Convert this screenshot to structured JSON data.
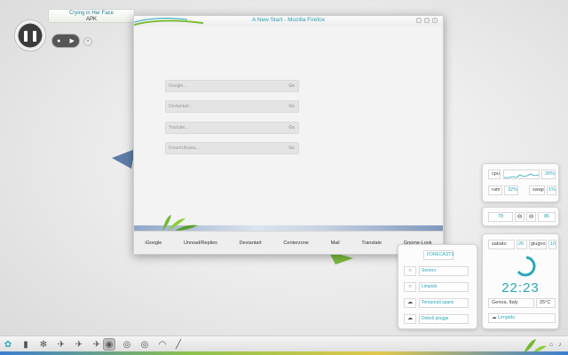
{
  "media_player": {
    "song": "Crying in Her Face",
    "artist": "APK",
    "play_icon": "pause-icon",
    "next_icon": "next-icon"
  },
  "firefox": {
    "title": "A New Start - Mozilla Firefox",
    "search_rows": [
      {
        "label": "Google...",
        "go": "Go"
      },
      {
        "label": "Deviantart...",
        "go": "Go"
      },
      {
        "label": "Youtube...",
        "go": "Go"
      },
      {
        "label": "ForumUbuntu...",
        "go": "Go"
      }
    ],
    "bookmarks": [
      "iGoogle",
      "Unread/Replies",
      "Deviantart",
      "Centerzone",
      "Mail",
      "Translate",
      "Gnome-Look"
    ]
  },
  "sysmon": {
    "cpu_label": "cpu",
    "cpu_value": "30%",
    "ram_label": "ram",
    "ram_value": "32%",
    "swap_label": "swap",
    "swap_value": "1%"
  },
  "volume": {
    "left_value": "78",
    "right_value": "86"
  },
  "clock": {
    "day": "sabato",
    "date_num": "26",
    "month": "giugno",
    "year_short": "10",
    "time": "22:23",
    "city": "Genoa, Italy",
    "temp": "25°C",
    "condition": "Limpido"
  },
  "forecast": {
    "header": "FORECASTS",
    "items": [
      {
        "icon": "clear-icon",
        "label": "Sereno"
      },
      {
        "icon": "clear-icon",
        "label": "Limpido"
      },
      {
        "icon": "storm-icon",
        "label": "Temporali sparsi"
      },
      {
        "icon": "rain-icon",
        "label": "Deboli piogge"
      }
    ]
  },
  "colors": {
    "accent": "#2aa8b8",
    "leaf": "#6fb82f"
  }
}
